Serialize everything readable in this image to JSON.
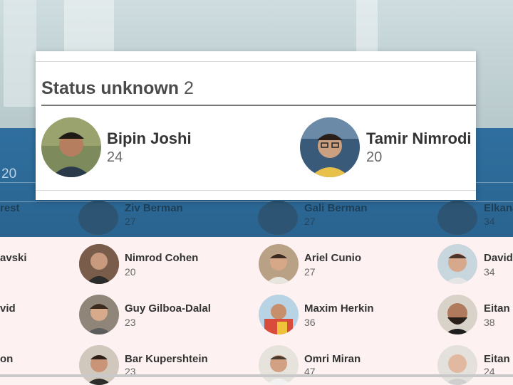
{
  "modal": {
    "title": "Status unknown",
    "count": "2",
    "people": [
      {
        "name": "Bipin Joshi",
        "age": "24"
      },
      {
        "name": "Tamir Nimrodi",
        "age": "20"
      }
    ]
  },
  "background_list": {
    "partial_count": "20",
    "faded_row": [
      {
        "name": "rest",
        "age": ""
      },
      {
        "name": "Ziv Berman",
        "age": "27"
      },
      {
        "name": "Gali Berman",
        "age": "27"
      },
      {
        "name": "Elkana",
        "age": "34"
      }
    ],
    "rows": [
      [
        {
          "name": "avski",
          "age": ""
        },
        {
          "name": "Nimrod Cohen",
          "age": "20"
        },
        {
          "name": "Ariel Cunio",
          "age": "27"
        },
        {
          "name": "David",
          "age": "34"
        }
      ],
      [
        {
          "name": "vid",
          "age": ""
        },
        {
          "name": "Guy Gilboa-Dalal",
          "age": "23"
        },
        {
          "name": "Maxim Herkin",
          "age": "36"
        },
        {
          "name": "Eitan",
          "age": "38"
        }
      ],
      [
        {
          "name": "on",
          "age": ""
        },
        {
          "name": "Bar Kupershtein",
          "age": "23"
        },
        {
          "name": "Omri Miran",
          "age": "47"
        },
        {
          "name": "Eitan",
          "age": "24"
        }
      ]
    ]
  },
  "colors": {
    "band_blue": "#2f6f9f",
    "list_bg": "#fdf1f1",
    "text_dark": "#333333"
  }
}
